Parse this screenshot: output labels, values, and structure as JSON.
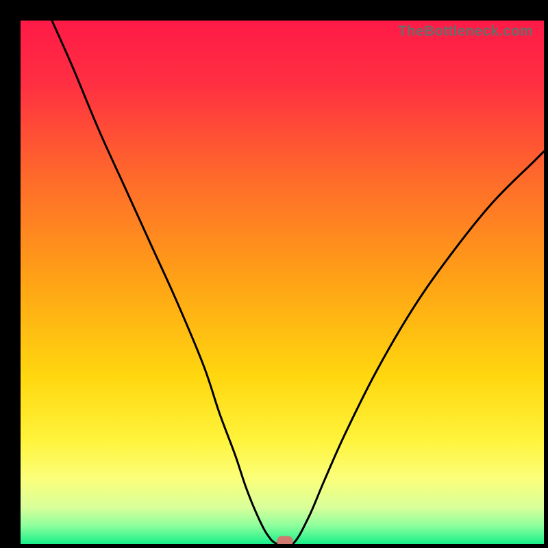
{
  "watermark": "TheBottleneck.com",
  "colors": {
    "gradient_stops": [
      {
        "offset": 0.0,
        "color": "#ff1a47"
      },
      {
        "offset": 0.12,
        "color": "#ff2f42"
      },
      {
        "offset": 0.3,
        "color": "#ff6a2b"
      },
      {
        "offset": 0.5,
        "color": "#ffa315"
      },
      {
        "offset": 0.68,
        "color": "#ffd70f"
      },
      {
        "offset": 0.8,
        "color": "#fff33a"
      },
      {
        "offset": 0.875,
        "color": "#fbff7a"
      },
      {
        "offset": 0.93,
        "color": "#d9ff9a"
      },
      {
        "offset": 0.965,
        "color": "#8eff9d"
      },
      {
        "offset": 1.0,
        "color": "#19f08a"
      }
    ],
    "curve": "#000000",
    "marker": "#cf7a71",
    "black": "#000000"
  },
  "chart_data": {
    "type": "line",
    "title": "",
    "xlabel": "",
    "ylabel": "",
    "xlim": [
      0,
      100
    ],
    "ylim": [
      0,
      100
    ],
    "grid": false,
    "series": [
      {
        "name": "bottleneck-curve",
        "x": [
          6,
          10,
          15,
          20,
          25,
          30,
          35,
          38,
          41,
          43,
          45,
          47,
          49,
          52,
          55,
          58,
          62,
          68,
          75,
          82,
          90,
          98,
          100
        ],
        "y": [
          100,
          91,
          79,
          68,
          57,
          46,
          34,
          25,
          17,
          11,
          6,
          2,
          0,
          0,
          5,
          12,
          21,
          33,
          45,
          55,
          65,
          73,
          75
        ]
      }
    ],
    "annotations": [
      {
        "name": "optimal-marker",
        "x": 50.5,
        "y": 0.5
      }
    ]
  }
}
